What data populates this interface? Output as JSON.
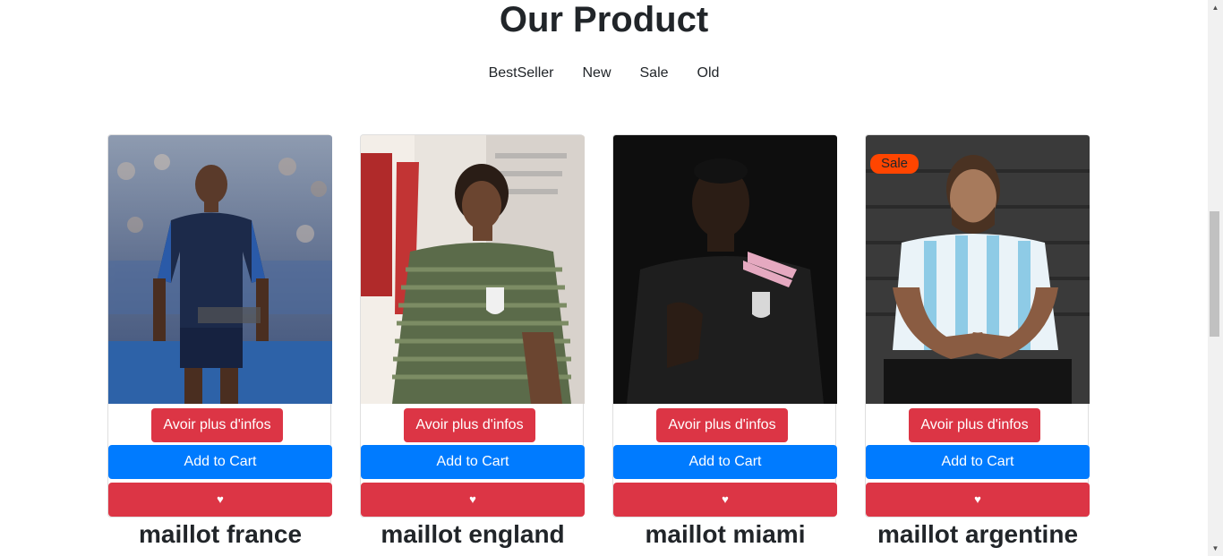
{
  "header": {
    "title": "Our Product"
  },
  "filters": [
    {
      "label": "BestSeller"
    },
    {
      "label": "New"
    },
    {
      "label": "Sale"
    },
    {
      "label": "Old"
    }
  ],
  "products": [
    {
      "name": "maillot france",
      "info_label": "Avoir plus d'infos",
      "cart_label": "Add to Cart",
      "fav_icon": "heart-icon",
      "badge": ""
    },
    {
      "name": "maillot england",
      "info_label": "Avoir plus d'infos",
      "cart_label": "Add to Cart",
      "fav_icon": "heart-icon",
      "badge": ""
    },
    {
      "name": "maillot miami",
      "info_label": "Avoir plus d'infos",
      "cart_label": "Add to Cart",
      "fav_icon": "heart-icon",
      "badge": ""
    },
    {
      "name": "maillot argentine",
      "info_label": "Avoir plus d'infos",
      "cart_label": "Add to Cart",
      "fav_icon": "heart-icon",
      "badge": "Sale"
    }
  ],
  "colors": {
    "info_button": "#dc3545",
    "cart_button": "#007bff",
    "fav_button": "#dc3545",
    "sale_badge": "#ff4500"
  },
  "scrollbar": {
    "up_icon": "scroll-up-arrow-icon",
    "down_icon": "scroll-down-arrow-icon"
  }
}
